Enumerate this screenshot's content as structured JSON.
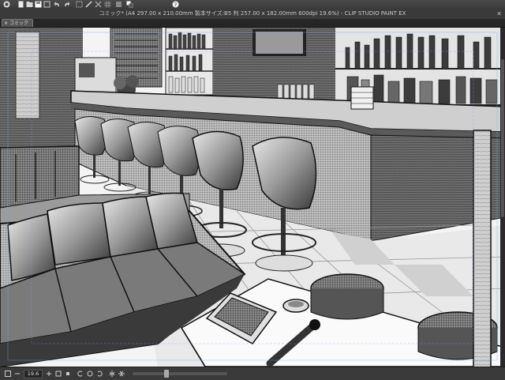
{
  "window": {
    "title": "コミック* (A4 297.00 x 210.00mm 製本サイズ:B5 判 257.00 x 182.00mm 600dpi 19.6%) - CLIP STUDIO PAINT EX",
    "close_glyph": "✕"
  },
  "tabs": [
    {
      "label": "コミック",
      "close_glyph": "×"
    }
  ],
  "toolbar": {
    "icons": [
      "clip-studio-icon",
      "new-icon",
      "open-icon",
      "save-icon",
      "undo-icon",
      "redo-icon",
      "clear-icon",
      "transform-icon",
      "ruler-icon",
      "snap-icon",
      "grid-icon",
      "snap-special-icon",
      "color-icon",
      "help-icon"
    ]
  },
  "statusbar": {
    "zoom_value": "19.6"
  },
  "colors": {
    "ui_dark": "#2e2e2e",
    "ui_panel": "#3a3a3a",
    "canvas_paper": "#ffffff"
  }
}
